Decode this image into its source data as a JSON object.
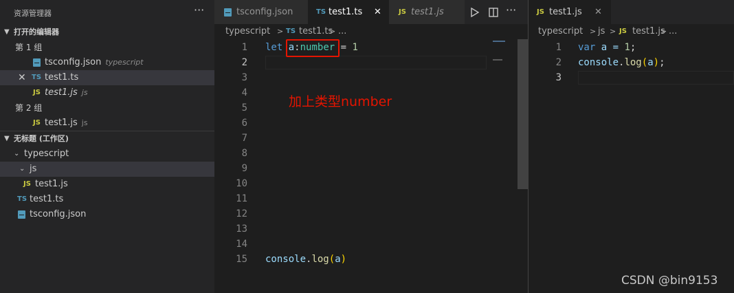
{
  "sidebar": {
    "title": "资源管理器",
    "more": "···",
    "open_editors": {
      "label": "打开的编辑器",
      "group1": {
        "label": "第 1 组",
        "files": [
          {
            "name": "tsconfig.json",
            "desc": "typescript"
          },
          {
            "name": "test1.ts",
            "desc": ""
          },
          {
            "name": "test1.js",
            "desc": "js"
          }
        ]
      },
      "group2": {
        "label": "第 2 组",
        "files": [
          {
            "name": "test1.js",
            "desc": "js"
          }
        ]
      }
    },
    "workspace": {
      "label": "无标题 (工作区)",
      "folder": "typescript",
      "subfolder": "js",
      "files": [
        "test1.js",
        "test1.ts",
        "tsconfig.json"
      ]
    }
  },
  "editor1": {
    "tabs": [
      {
        "label": "tsconfig.json"
      },
      {
        "label": "test1.ts"
      },
      {
        "label": "test1.js"
      }
    ],
    "close": "✕",
    "breadcrumb": [
      "typescript",
      "test1.ts",
      "..."
    ],
    "line_numbers": [
      "1",
      "2",
      "3",
      "4",
      "5",
      "6",
      "7",
      "8",
      "9",
      "10",
      "11",
      "12",
      "13",
      "14",
      "15"
    ],
    "annotation": "加上类型number",
    "annotation_color": "#e51400",
    "code": {
      "line1": {
        "kw": "let",
        "var": "a",
        "colon": ":",
        "type": "number",
        "rest": " = ",
        "num": "1"
      },
      "line15": {
        "obj": "console",
        "dot": ".",
        "fn": "log",
        "open": "(",
        "arg": "a",
        "close": ")"
      }
    }
  },
  "editor2": {
    "tab": "test1.js",
    "close": "✕",
    "breadcrumb": [
      "typescript",
      "js",
      "test1.js",
      "..."
    ],
    "line_numbers": [
      "1",
      "2",
      "3"
    ],
    "code": {
      "line1": {
        "kw": "var",
        "rest": " a = ",
        "num": "1",
        "semi": ";"
      },
      "line2": {
        "obj": "console",
        "dot": ".",
        "fn": "log",
        "open": "(",
        "arg": "a",
        "close": ")",
        "semi": ";"
      }
    }
  },
  "watermark": "CSDN @bin9153",
  "icons": {
    "ts": "TS",
    "js": "JS"
  }
}
